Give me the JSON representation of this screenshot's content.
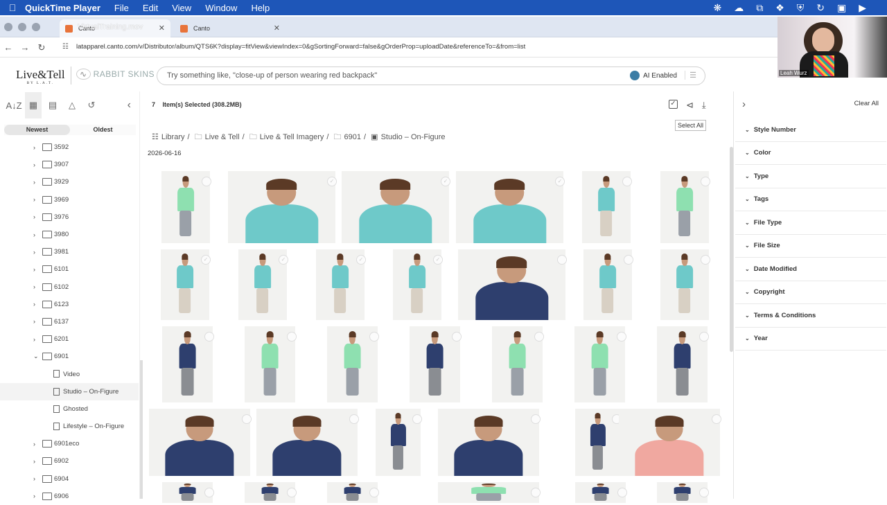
{
  "menubar": {
    "app": "QuickTime Player",
    "items": [
      "File",
      "Edit",
      "View",
      "Window",
      "Help"
    ]
  },
  "browser": {
    "tabs": [
      {
        "title": "Canto"
      },
      {
        "title": "Canto"
      }
    ],
    "recording_title": "VirtualTraining.mov",
    "url": "latapparel.canto.com/v/Distributor/album/QTS6K?display=fitView&viewIndex=0&gSortingForward=false&gOrderProp=uploadDate&referenceTo=&from=list"
  },
  "header": {
    "logo": "Live&Tell",
    "logo_sub": "BY L.A.T.",
    "logo2": "RABBIT SKINS",
    "search_placeholder": "Try something like, \"close-up of person wearing red backpack\"",
    "ai_label": "AI Enabled"
  },
  "webcam": {
    "name": "Leah Wurz"
  },
  "sidebar": {
    "sort": {
      "newest": "Newest",
      "oldest": "Oldest"
    },
    "folders": [
      {
        "label": "3592",
        "type": "folder",
        "expanded": false
      },
      {
        "label": "3907",
        "type": "folder",
        "expanded": false
      },
      {
        "label": "3929",
        "type": "folder",
        "expanded": false
      },
      {
        "label": "3969",
        "type": "folder",
        "expanded": false
      },
      {
        "label": "3976",
        "type": "folder",
        "expanded": false
      },
      {
        "label": "3980",
        "type": "folder",
        "expanded": false
      },
      {
        "label": "3981",
        "type": "folder",
        "expanded": false
      },
      {
        "label": "6101",
        "type": "folder",
        "expanded": false
      },
      {
        "label": "6102",
        "type": "folder",
        "expanded": false
      },
      {
        "label": "6123",
        "type": "folder",
        "expanded": false
      },
      {
        "label": "6137",
        "type": "folder",
        "expanded": false
      },
      {
        "label": "6201",
        "type": "folder",
        "expanded": false
      },
      {
        "label": "6901",
        "type": "folder",
        "expanded": true
      },
      {
        "label": "Video",
        "type": "album"
      },
      {
        "label": "Studio – On-Figure",
        "type": "album",
        "selected": true
      },
      {
        "label": "Ghosted",
        "type": "album"
      },
      {
        "label": "Lifestyle – On-Figure",
        "type": "album"
      },
      {
        "label": "6901eco",
        "type": "folder",
        "expanded": false
      },
      {
        "label": "6902",
        "type": "folder",
        "expanded": false
      },
      {
        "label": "6904",
        "type": "folder",
        "expanded": false
      },
      {
        "label": "6906",
        "type": "folder",
        "expanded": false
      }
    ]
  },
  "main": {
    "selected_count": "7",
    "selected_text": "Item(s) Selected (308.2MB)",
    "tooltip": "Select All",
    "breadcrumbs": [
      "Library",
      "Live & Tell",
      "Live & Tell Imagery",
      "6901",
      "Studio – On-Figure"
    ],
    "date": "2026-06-16"
  },
  "filters": {
    "clear_all": "Clear All",
    "items": [
      "Style Number",
      "Color",
      "Type",
      "Tags",
      "File Type",
      "File Size",
      "Date Modified",
      "Copyright",
      "Terms & Conditions",
      "Year"
    ]
  },
  "colors": {
    "menubar": "#1e56b8",
    "mint": "#8ee0b0",
    "aqua": "#6ec9c9",
    "navy": "#2e3f6e",
    "pink": "#f0a8a0"
  }
}
